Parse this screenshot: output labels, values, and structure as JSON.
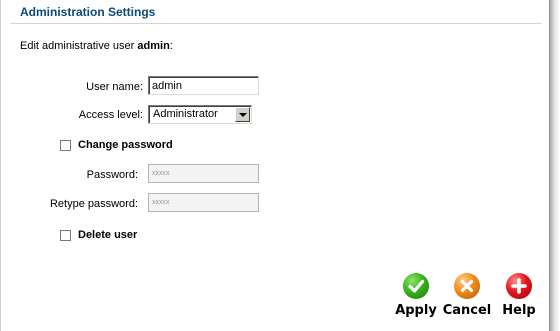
{
  "title": "Administration Settings",
  "intro": {
    "prefix": "Edit administrative user ",
    "username": "admin",
    "suffix": ":"
  },
  "form": {
    "username_label": "User name:",
    "username_value": "admin",
    "access_label": "Access level:",
    "access_value": "Administrator",
    "change_password_label": "Change password",
    "change_password_checked": false,
    "password_label": "Password:",
    "password_value": "xxxxx",
    "retype_label": "Retype password:",
    "retype_value": "xxxxx",
    "delete_user_label": "Delete user",
    "delete_user_checked": false
  },
  "actions": {
    "apply_label": "Apply",
    "cancel_label": "Cancel",
    "help_label": "Help"
  },
  "colors": {
    "title": "#0b4a7a",
    "apply": "#36b31e",
    "cancel": "#f08a1a",
    "help": "#e3151b"
  }
}
